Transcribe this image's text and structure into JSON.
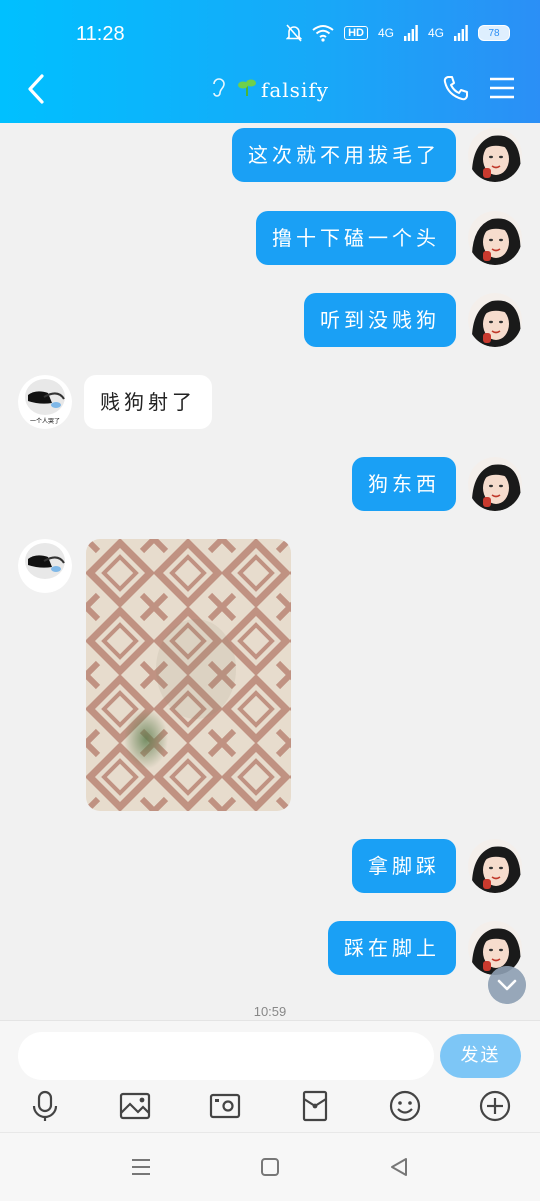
{
  "status_bar": {
    "time": "11:28",
    "hd": "HD",
    "net1": "4G",
    "net2": "4G",
    "battery": "78"
  },
  "header": {
    "title": "falsify",
    "back_icon": "chevron-left-icon",
    "call_icon": "phone-icon",
    "menu_icon": "menu-icon"
  },
  "messages": [
    {
      "from": "me",
      "text": "这次就不用拔毛了"
    },
    {
      "from": "me",
      "text": "撸十下磕一个头"
    },
    {
      "from": "me",
      "text": "听到没贱狗"
    },
    {
      "from": "other",
      "text": "贱狗射了"
    },
    {
      "from": "me",
      "text": "狗东西"
    },
    {
      "from": "other",
      "type": "image"
    },
    {
      "from": "me",
      "text": "拿脚踩"
    },
    {
      "from": "me",
      "text": "踩在脚上"
    }
  ],
  "other_avatar_caption": "一个人哭了",
  "timestamp": "10:59",
  "input": {
    "placeholder": "",
    "value": "",
    "send_label": "发送"
  },
  "toolbar": [
    "microphone-icon",
    "image-icon",
    "camera-icon",
    "red-packet-icon",
    "emoji-icon",
    "plus-icon"
  ],
  "colors": {
    "header": "#18a8f8",
    "bubble_me": "#1aa0f5",
    "send": "#7dc6f6",
    "bg": "#f1f1f1"
  }
}
